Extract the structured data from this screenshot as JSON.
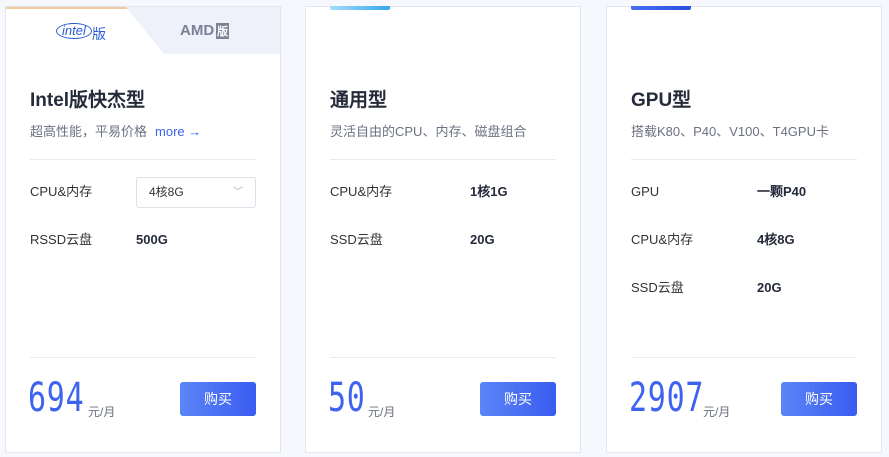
{
  "cards": [
    {
      "tabs": {
        "intel_logo": "intel",
        "intel_suffix": "版",
        "amd_logo": "AMD",
        "amd_suffix": "版"
      },
      "title": "Intel版快杰型",
      "subtitle": "超高性能，平易价格",
      "more": "more →",
      "specs": [
        {
          "label": "CPU&内存",
          "value": "4核8G"
        },
        {
          "label": "RSSD云盘",
          "value": "500G"
        }
      ],
      "price": "694",
      "unit": "元/月",
      "buy": "购买"
    },
    {
      "title": "通用型",
      "subtitle": "灵活自由的CPU、内存、磁盘组合",
      "specs": [
        {
          "label": "CPU&内存",
          "value": "1核1G"
        },
        {
          "label": "SSD云盘",
          "value": "20G"
        }
      ],
      "price": "50",
      "unit": "元/月",
      "buy": "购买"
    },
    {
      "title": "GPU型",
      "subtitle": "搭载K80、P40、V100、T4GPU卡",
      "specs": [
        {
          "label": "GPU",
          "value": "一颗P40"
        },
        {
          "label": "CPU&内存",
          "value": "4核8G"
        },
        {
          "label": "SSD云盘",
          "value": "20G"
        }
      ],
      "price": "2907",
      "unit": "元/月",
      "buy": "购买"
    }
  ],
  "colors": {
    "accent": "#3d63f0"
  }
}
